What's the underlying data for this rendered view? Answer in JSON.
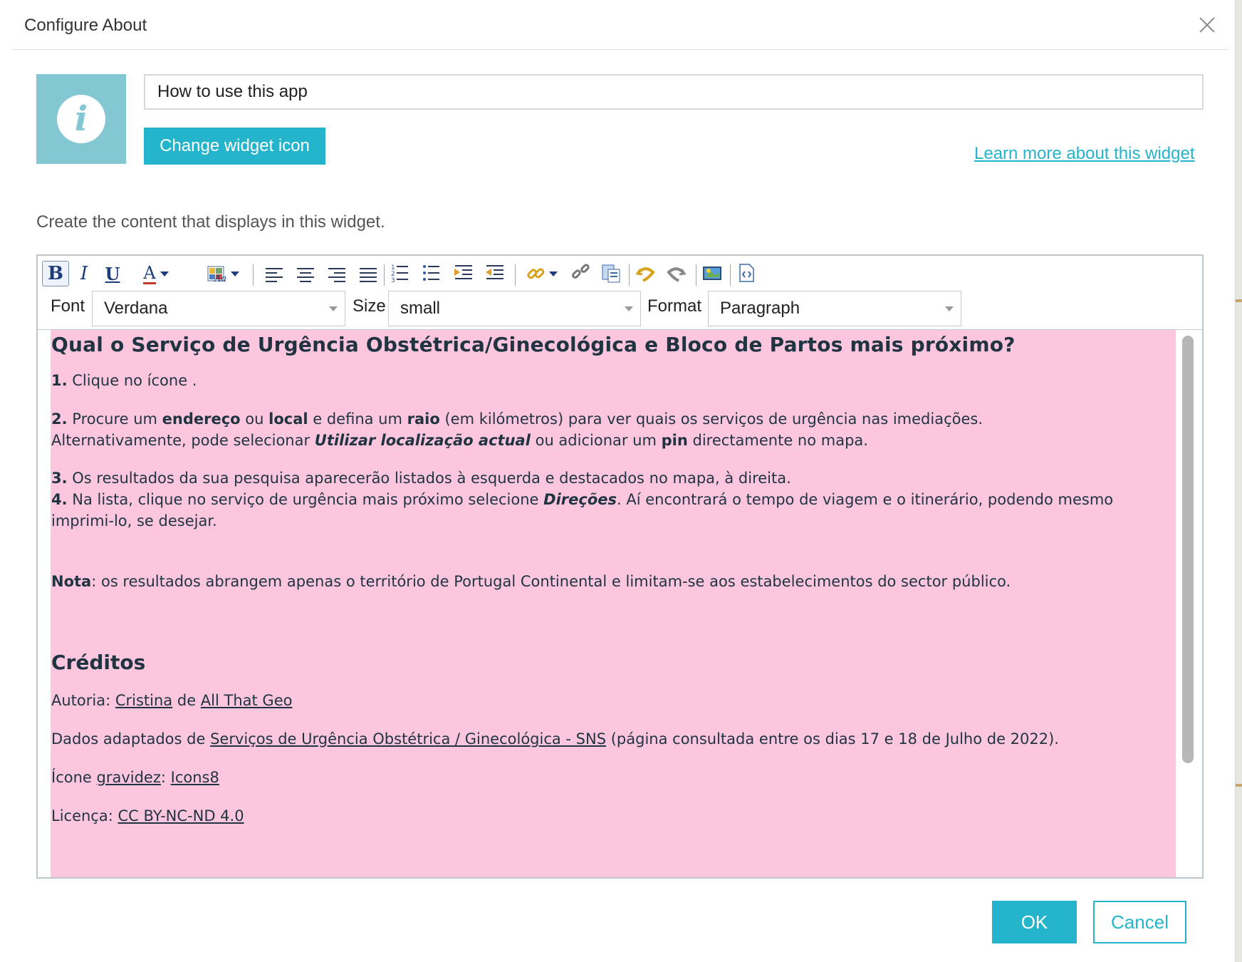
{
  "dialog": {
    "title": "Configure About",
    "close_icon": "close-icon"
  },
  "widget": {
    "icon": "info-icon",
    "icon_glyph": "i",
    "title_value": "How to use this app",
    "change_icon_label": "Change widget icon",
    "learn_more_label": "Learn more about this widget",
    "description": "Create the content that displays in this widget."
  },
  "toolbar": {
    "bold": "B",
    "italic": "I",
    "underline": "U",
    "font_color": "A",
    "font_label": "Font",
    "font_value": "Verdana",
    "size_label": "Size",
    "size_value": "small",
    "format_label": "Format",
    "format_value": "Paragraph",
    "icons": [
      "bold-icon",
      "italic-icon",
      "underline-icon",
      "font-color-icon",
      "highlight-color-icon",
      "align-left-icon",
      "align-center-icon",
      "align-right-icon",
      "justify-icon",
      "numbered-list-icon",
      "bulleted-list-icon",
      "indent-icon",
      "outdent-icon",
      "link-icon",
      "unlink-icon",
      "paste-icon",
      "undo-icon",
      "redo-icon",
      "insert-image-icon",
      "view-source-icon"
    ]
  },
  "content": {
    "heading": "Qual o Serviço de Urgência Obstétrica/Ginecológica e Bloco de Partos mais próximo?",
    "step1_num": "1.",
    "step1_text": " Clique no ícone .",
    "step2_num": "2.",
    "step2_a": " Procure um ",
    "step2_b": "endereço",
    "step2_c": " ou ",
    "step2_d": "local",
    "step2_e": " e defina um ",
    "step2_f": "raio",
    "step2_g": " (em kilómetros) para ver quais os serviços de urgência nas imediações.",
    "step2_line2_a": "Alternativamente, pode selecionar ",
    "step2_line2_b": "Utilizar localização actual",
    "step2_line2_c": "  ou adicionar um ",
    "step2_line2_d": "pin",
    "step2_line2_e": "  directamente no mapa.",
    "step3_num": "3.",
    "step3_text": " Os resultados da sua pesquisa aparecerão listados à esquerda e destacados no mapa, à direita.",
    "step4_num": "4.",
    "step4_a": " Na lista, clique no serviço de urgência mais próximo selecione ",
    "step4_b": "Direções",
    "step4_c": ". Aí encontrará o tempo de viagem e o itinerário, podendo mesmo",
    "step4_line2": "imprimi-lo, se desejar.",
    "note_label": "Nota",
    "note_text": ": os resultados abrangem apenas o território de Portugal Continental e limitam-se aos estabelecimentos do sector público.",
    "credits_heading": "Créditos",
    "author_prefix": "Autoria: ",
    "author_name": "Cristina",
    "author_mid": " de ",
    "author_org": "All That Geo",
    "data_prefix": "Dados adaptados de ",
    "data_link": "Serviços de Urgência Obstétrica / Ginecológica - SNS",
    "data_suffix": " (página consultada entre os dias 17 e 18 de Julho de 2022).",
    "icon_prefix": "Ícone ",
    "icon_word": "gravidez",
    "icon_sep": ": ",
    "icon_source": "Icons8",
    "license_prefix": "Licença: ",
    "license_link": "CC BY-NC-ND 4.0"
  },
  "footer": {
    "ok_label": "OK",
    "cancel_label": "Cancel"
  },
  "colors": {
    "accent": "#24b5cc",
    "icon_bg": "#83c7d2",
    "content_bg": "#fcc6de",
    "text_dark": "#1f3440"
  }
}
